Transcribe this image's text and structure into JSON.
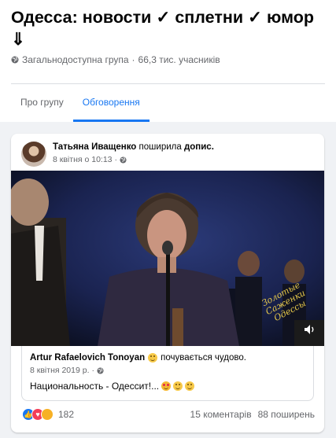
{
  "group": {
    "title": "Одесса: новости ✓ сплетни ✓ юмор ⇓",
    "privacy": "Загальнодоступна група",
    "separator": "·",
    "members": "66,3 тис. учасників"
  },
  "tabs": [
    {
      "label": "Про групу",
      "active": false
    },
    {
      "label": "Обговорення",
      "active": true
    }
  ],
  "post": {
    "author": "Татьяна Иващенко",
    "action": "поширила",
    "object": "допис.",
    "date": "8 квітня о 10:13",
    "separator": "·",
    "icons": {
      "privacy": "globe-icon",
      "avatar": "avatar-photo"
    },
    "video": {
      "watermark": "Золотые Саженки Одессы",
      "volume_icon": "volume-icon"
    },
    "shared": {
      "author": "Artur Rafaelovich Tonoyan",
      "feeling": "почувається чудово.",
      "date": "8 квітня 2019 р.",
      "separator": "·",
      "text": "Национальность - Одессит!..."
    },
    "reactions": {
      "types": [
        "like",
        "love",
        "haha"
      ],
      "count": "182"
    },
    "comments": "15 коментарів",
    "shares": "88 поширень"
  },
  "colors": {
    "accent": "#1877f2",
    "background": "#f0f2f5",
    "secondary_text": "#65676b"
  }
}
